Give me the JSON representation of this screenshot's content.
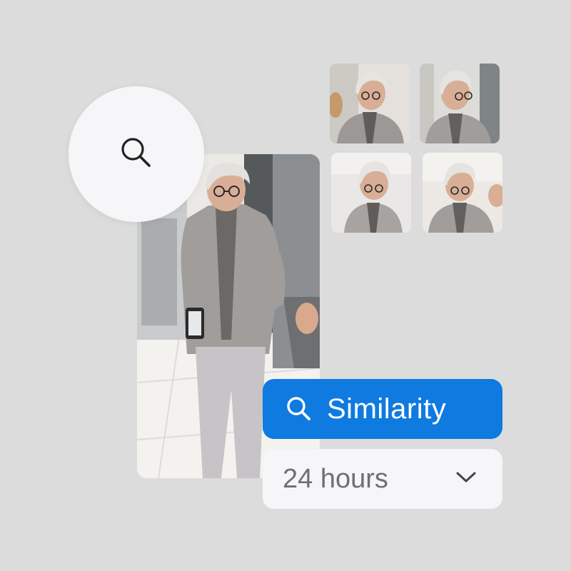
{
  "search": {
    "icon": "search-icon",
    "color": "#222222"
  },
  "results": {
    "thumbnails": [
      "thumbnail-1",
      "thumbnail-2",
      "thumbnail-3",
      "thumbnail-4"
    ]
  },
  "filters": {
    "mode_label": "Similarity",
    "mode_icon": "search-icon",
    "mode_color": "#0f7ae0",
    "time_range": "24 hours",
    "time_icon": "chevron-down-icon"
  }
}
